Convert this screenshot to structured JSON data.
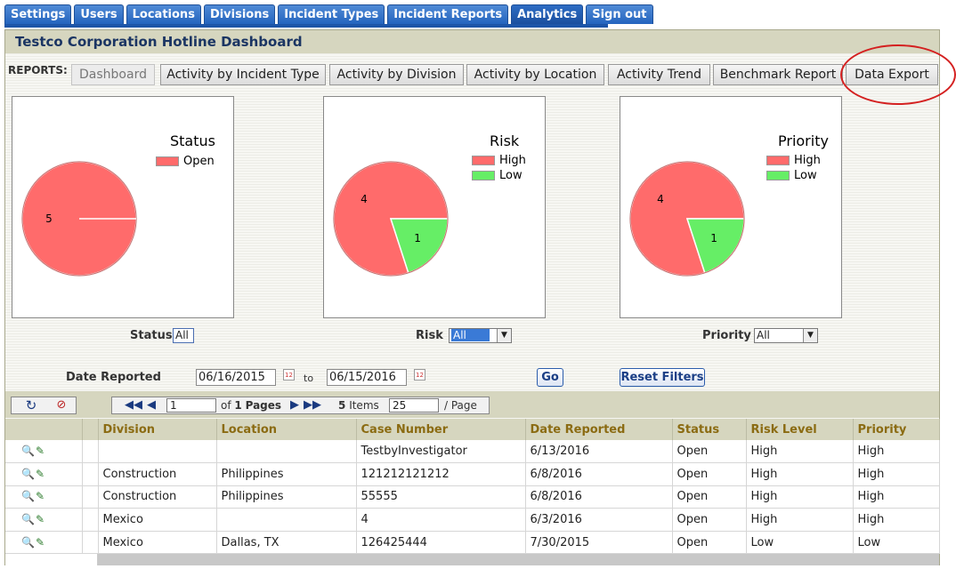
{
  "nav_tabs": [
    "Settings",
    "Users",
    "Locations",
    "Divisions",
    "Incident Types",
    "Incident Reports",
    "Analytics",
    "Sign out"
  ],
  "active_tab": "Analytics",
  "dashboard": {
    "title": "Testco Corporation Hotline Dashboard",
    "reports_label": "REPORTS:",
    "report_buttons": [
      "Dashboard",
      "Activity by Incident Type",
      "Activity by Division",
      "Activity by Location",
      "Activity Trend",
      "Benchmark Report",
      "Data Export"
    ]
  },
  "chart_data": [
    {
      "type": "pie",
      "title": "Status",
      "slices": [
        {
          "label": "Open",
          "value": 5,
          "color": "#ff6b6b"
        }
      ]
    },
    {
      "type": "pie",
      "title": "Risk",
      "slices": [
        {
          "label": "High",
          "value": 4,
          "color": "#ff6b6b"
        },
        {
          "label": "Low",
          "value": 1,
          "color": "#66ee66"
        }
      ]
    },
    {
      "type": "pie",
      "title": "Priority",
      "slices": [
        {
          "label": "High",
          "value": 4,
          "color": "#ff6b6b"
        },
        {
          "label": "Low",
          "value": 1,
          "color": "#66ee66"
        }
      ]
    }
  ],
  "filters": {
    "status": {
      "label": "Status",
      "value": "All"
    },
    "risk": {
      "label": "Risk",
      "value": "All"
    },
    "priority": {
      "label": "Priority",
      "value": "All"
    },
    "date_reported": {
      "label": "Date Reported",
      "from": "06/16/2015",
      "to_label": "to",
      "to": "06/15/2016"
    },
    "go_label": "Go",
    "reset_label": "Reset Filters"
  },
  "pager": {
    "page": "1",
    "of_pages_prefix": "of",
    "total_pages": "1",
    "pages_label": "Pages",
    "items_count": "5",
    "items_label": "Items",
    "page_size": "25",
    "per_page_label": "/ Page"
  },
  "table": {
    "columns": [
      "Division",
      "Location",
      "Case Number",
      "Date Reported",
      "Status",
      "Risk Level",
      "Priority"
    ],
    "rows": [
      [
        "",
        "",
        "TestbyInvestigator",
        "6/13/2016",
        "Open",
        "High",
        "High"
      ],
      [
        "Construction",
        "Philippines",
        "121212121212",
        "6/8/2016",
        "Open",
        "High",
        "High"
      ],
      [
        "Construction",
        "Philippines",
        "55555",
        "6/8/2016",
        "Open",
        "High",
        "High"
      ],
      [
        "Mexico",
        "",
        "4",
        "6/3/2016",
        "Open",
        "High",
        "High"
      ],
      [
        "Mexico",
        "Dallas, TX",
        "126425444",
        "7/30/2015",
        "Open",
        "Low",
        "Low"
      ]
    ]
  },
  "icons": {
    "refresh": "refresh-icon",
    "clear_filter": "clear-filter-icon",
    "view": "magnifier-icon",
    "edit": "edit-icon"
  }
}
